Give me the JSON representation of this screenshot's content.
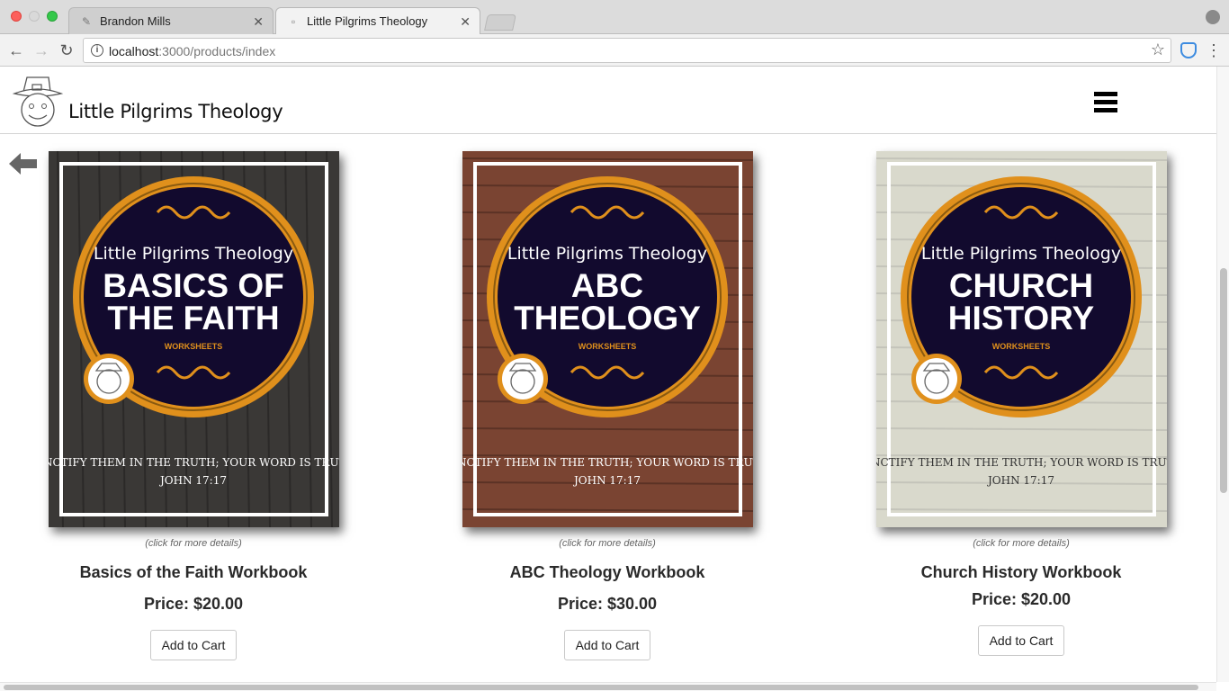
{
  "browser": {
    "tabs": [
      {
        "title": "Brandon Mills",
        "icon": "pencil-icon"
      },
      {
        "title": "Little Pilgrims Theology",
        "icon": "page-icon"
      }
    ],
    "url_host": "localhost",
    "url_path": ":3000/products/index"
  },
  "site": {
    "title": "Little Pilgrims Theology"
  },
  "products": [
    {
      "cover_brand": "Little Pilgrims Theology",
      "cover_title_line1": "BASICS OF",
      "cover_title_line2": "THE FAITH",
      "cover_subtitle": "WORKSHEETS",
      "cover_quote": "\"SANCTIFY THEM IN THE TRUTH; YOUR WORD IS TRUTH.\"",
      "cover_ref": "JOHN 17:17",
      "cover_bg": "#3a3836",
      "hint": "(click for more details)",
      "name": "Basics of the Faith Workbook",
      "price": "Price: $20.00",
      "button": "Add to Cart"
    },
    {
      "cover_brand": "Little Pilgrims Theology",
      "cover_title_line1": "ABC",
      "cover_title_line2": "THEOLOGY",
      "cover_subtitle": "WORKSHEETS",
      "cover_quote": "\"SANCTIFY THEM IN THE TRUTH; YOUR WORD IS TRUTH.\"",
      "cover_ref": "JOHN 17:17",
      "cover_bg": "#7a4432",
      "hint": "(click for more details)",
      "name": "ABC Theology Workbook",
      "price": "Price: $30.00",
      "button": "Add to Cart"
    },
    {
      "cover_brand": "Little Pilgrims Theology",
      "cover_title_line1": "CHURCH",
      "cover_title_line2": "HISTORY",
      "cover_subtitle": "WORKSHEETS",
      "cover_quote": "\"SANCTIFY THEM IN THE TRUTH; YOUR WORD IS TRUTH.\"",
      "cover_ref": "JOHN 17:17",
      "cover_bg": "#d9d9cc",
      "hint": "(click for more details)",
      "name": "Church History Workbook",
      "price": "Price: $20.00",
      "button": "Add to Cart"
    }
  ],
  "colors": {
    "cover_circle": "#120a2e",
    "cover_ring": "#e0901c"
  }
}
